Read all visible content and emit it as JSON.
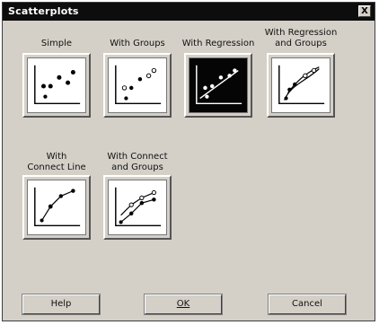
{
  "window": {
    "title": "Scatterplots",
    "close_glyph": "X"
  },
  "options": [
    {
      "label": "Simple"
    },
    {
      "label": "With Groups"
    },
    {
      "label": "With Regression"
    },
    {
      "label": "With Regression\nand Groups"
    },
    {
      "label": "With\nConnect Line"
    },
    {
      "label": "With Connect\nand Groups"
    }
  ],
  "buttons": {
    "help": "Help",
    "ok": "OK",
    "cancel": "Cancel"
  }
}
